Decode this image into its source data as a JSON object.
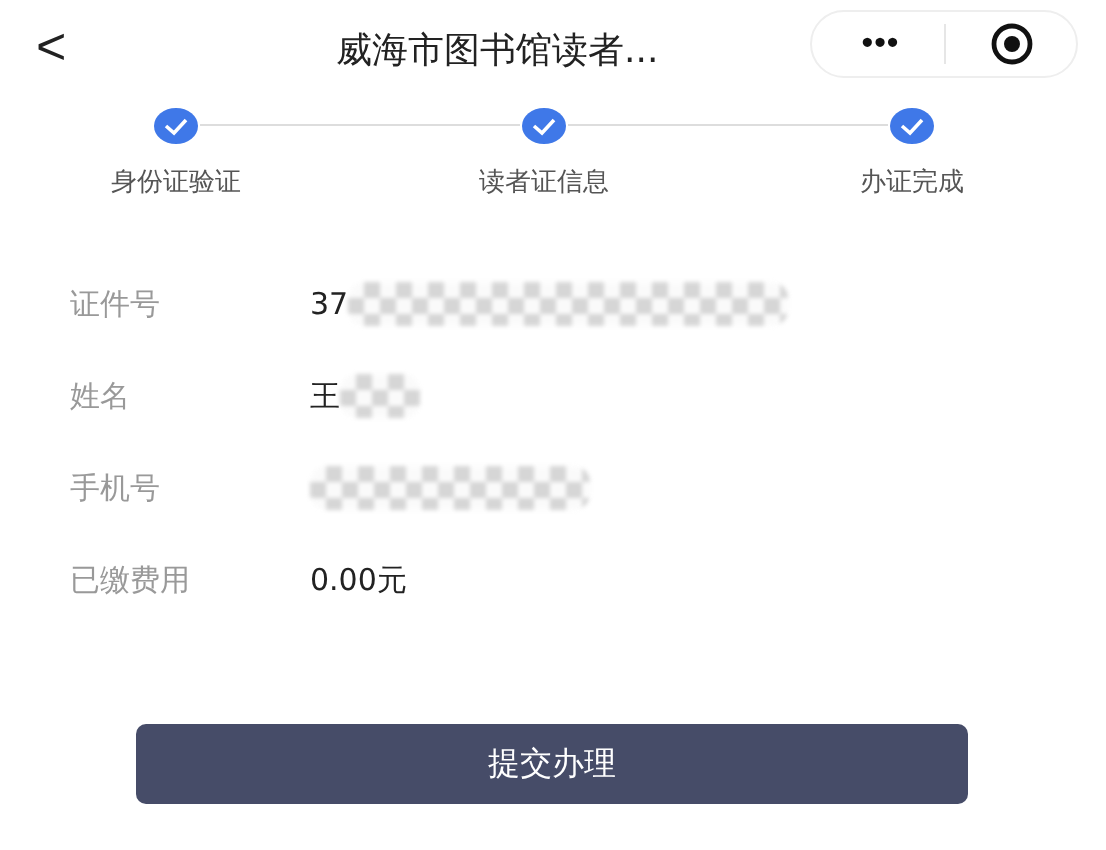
{
  "header": {
    "back": "<",
    "title": "威海市图书馆读者...",
    "more": "•••"
  },
  "steps": [
    {
      "label": "身份证验证",
      "done": true
    },
    {
      "label": "读者证信息",
      "done": true
    },
    {
      "label": "办证完成",
      "done": true
    }
  ],
  "fields": [
    {
      "label": "证件号",
      "value": "37",
      "redacted": true
    },
    {
      "label": "姓名",
      "value": "王",
      "redacted": true
    },
    {
      "label": "手机号",
      "redacted": true
    },
    {
      "label": "已缴费用",
      "value": "0.00元",
      "redacted": false
    }
  ],
  "submit": "提交办理"
}
